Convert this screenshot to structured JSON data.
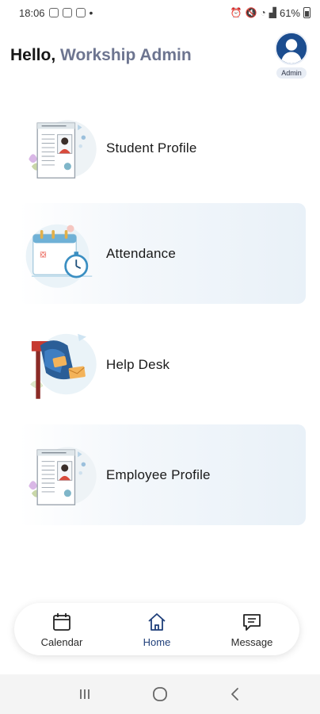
{
  "status_bar": {
    "time": "18:06",
    "battery": "61%"
  },
  "header": {
    "greeting_prefix": "Hello, ",
    "user_name": "Workship Admin",
    "role_badge": "Admin"
  },
  "menu": {
    "items": [
      {
        "label": "Student Profile",
        "icon": "profile-document-icon"
      },
      {
        "label": "Attendance",
        "icon": "calendar-stopwatch-icon"
      },
      {
        "label": "Help Desk",
        "icon": "mailbox-icon"
      },
      {
        "label": "Employee Profile",
        "icon": "profile-document-icon"
      }
    ]
  },
  "bottom_nav": {
    "items": [
      {
        "label": "Calendar",
        "icon": "calendar-icon"
      },
      {
        "label": "Home",
        "icon": "home-icon",
        "active": true
      },
      {
        "label": "Message",
        "icon": "message-icon"
      }
    ]
  },
  "colors": {
    "accent": "#1f3f7a",
    "name_text": "#6d7590",
    "avatar_bg": "#1c4d8f"
  }
}
